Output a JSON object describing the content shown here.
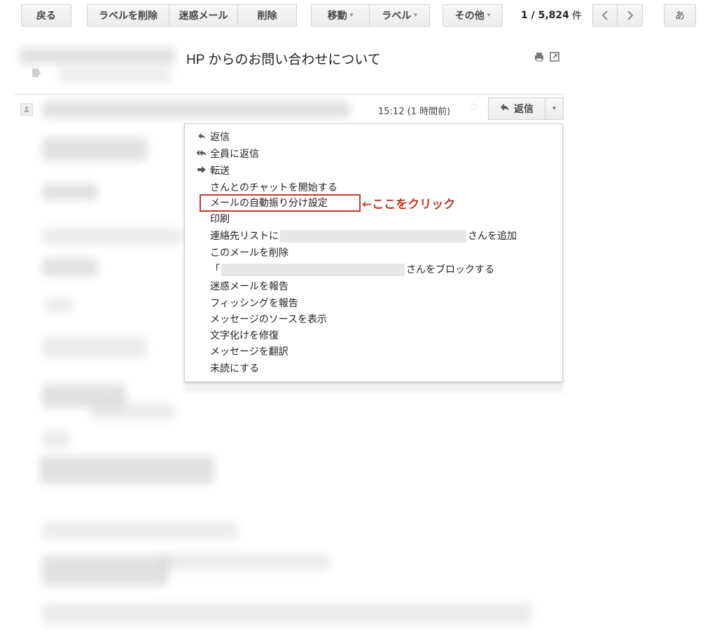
{
  "toolbar": {
    "back": "戻る",
    "remove_label": "ラベルを削除",
    "spam": "迷惑メール",
    "delete": "削除",
    "move": "移動",
    "labels": "ラベル",
    "more": "その他",
    "page_range": "1 / 5,824",
    "page_unit": "件",
    "input_tool": "あ",
    "dropdown_caret": "▾",
    "prev_icon": "chevron-left-icon",
    "next_icon": "chevron-right-icon"
  },
  "message": {
    "subject": "HP からのお問い合わせについて",
    "timestamp": "15:12 (1 時間前)",
    "reply_label": "返信",
    "print_icon": "print-icon",
    "newwindow_icon": "new-window-icon"
  },
  "menu": {
    "items": [
      {
        "label": "返信",
        "icon": "reply-icon"
      },
      {
        "label": "全員に返信",
        "icon": "reply-all-icon"
      },
      {
        "label": "転送",
        "icon": "forward-icon"
      },
      {
        "label": "さんとのチャットを開始する"
      },
      {
        "label": "メールの自動振り分け設定"
      },
      {
        "label": "印刷"
      },
      {
        "prefix": "連絡先リストに",
        "suffix": "さんを追加"
      },
      {
        "label": "このメールを削除"
      },
      {
        "prefix": "「",
        "suffix": "さんをブロックする"
      },
      {
        "label": "迷惑メールを報告"
      },
      {
        "label": "フィッシングを報告"
      },
      {
        "label": "メッセージのソースを表示"
      },
      {
        "label": "文字化けを修復"
      },
      {
        "label": "メッセージを翻訳"
      },
      {
        "label": "未読にする"
      }
    ]
  },
  "annotation": {
    "text": "←ここをクリック",
    "color": "#c0392b"
  }
}
